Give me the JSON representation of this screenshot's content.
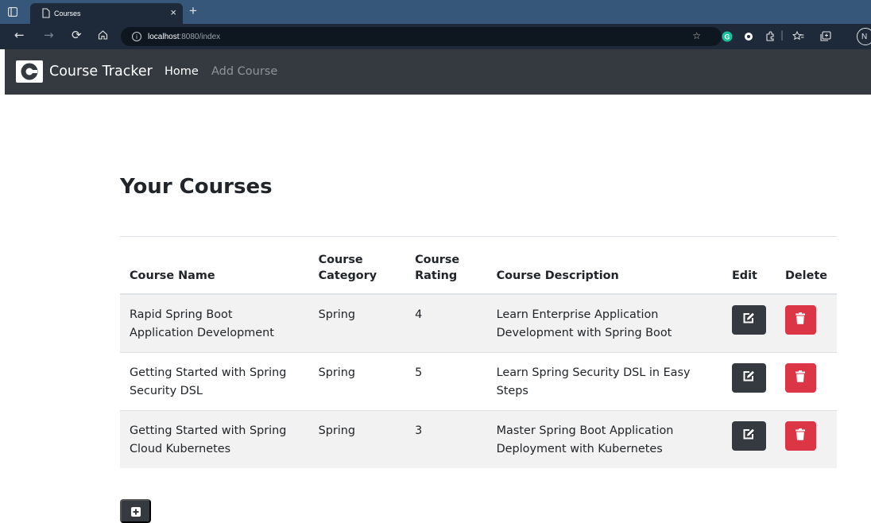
{
  "browser": {
    "tab_title": "Courses",
    "tab_close": "×",
    "new_tab": "+",
    "url_host": "localhost",
    "url_path": ":8080/index",
    "info_glyph": "i",
    "profile_initial": "N",
    "icons": [
      "sidebar-icon",
      "page-icon",
      "back-icon",
      "forward-icon",
      "refresh-icon",
      "home-icon",
      "info-icon",
      "add-favorite-icon",
      "grammarly-icon",
      "extension-dot-icon",
      "extensions-icon",
      "favorites-icon",
      "collections-icon",
      "profile-icon"
    ]
  },
  "navbar": {
    "brand": "Course Tracker",
    "links": [
      "Home",
      "Add Course"
    ],
    "background": "#343a40"
  },
  "main": {
    "title": "Your Courses",
    "table": {
      "headers": [
        "Course Name",
        "Course Category",
        "Course Rating",
        "Course Description",
        "Edit",
        "Delete"
      ],
      "rows": [
        {
          "name": "Rapid Spring Boot Application Development",
          "category": "Spring",
          "rating": "4",
          "description": "Learn Enterprise Application Development with Spring Boot"
        },
        {
          "name": "Getting Started with Spring Security DSL",
          "category": "Spring",
          "rating": "5",
          "description": "Learn Spring Security DSL in Easy Steps"
        },
        {
          "name": "Getting Started with Spring Cloud Kubernetes",
          "category": "Spring",
          "rating": "3",
          "description": "Master Spring Boot Application Deployment with Kubernetes"
        }
      ]
    }
  },
  "colors": {
    "edit_button": "#343a40",
    "delete_button": "#dc3545",
    "stripe": "#f2f2f2"
  }
}
